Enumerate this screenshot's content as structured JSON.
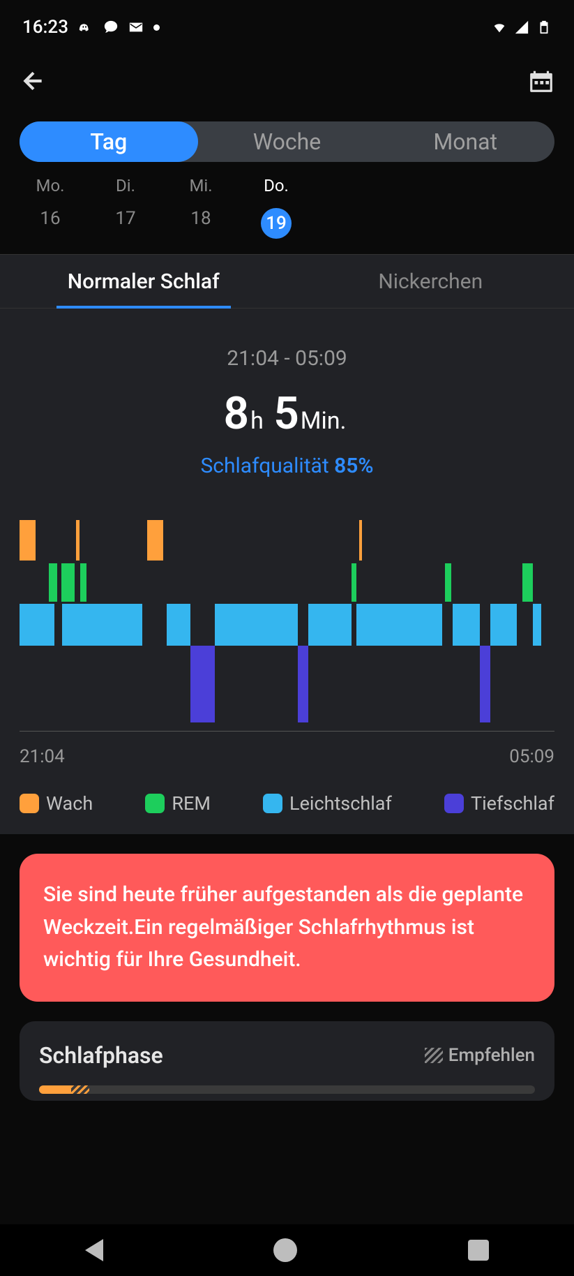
{
  "status": {
    "time": "16:23"
  },
  "segmented": {
    "items": [
      "Tag",
      "Woche",
      "Monat"
    ],
    "active": 0
  },
  "days": [
    {
      "wd": "Mo.",
      "num": "16"
    },
    {
      "wd": "Di.",
      "num": "17"
    },
    {
      "wd": "Mi.",
      "num": "18"
    },
    {
      "wd": "Do.",
      "num": "19"
    }
  ],
  "days_selected": 3,
  "tabs": {
    "items": [
      "Normaler Schlaf",
      "Nickerchen"
    ],
    "active": 0
  },
  "summary": {
    "time_range": "21:04 - 05:09",
    "hours": "8",
    "hours_unit": "h",
    "minutes": "5",
    "minutes_unit": "Min.",
    "quality_label": "Schlafqualität",
    "quality_pct": "85%"
  },
  "chart_data": {
    "type": "bar",
    "xlabel": "",
    "ylabel": "",
    "start_label": "21:04",
    "end_label": "05:09",
    "stages": [
      "wake",
      "rem",
      "light",
      "deep"
    ],
    "segments": [
      {
        "stage": "wake",
        "start_pct": 0,
        "width_pct": 3.0
      },
      {
        "stage": "rem",
        "start_pct": 5.5,
        "width_pct": 1.5
      },
      {
        "stage": "rem",
        "start_pct": 7.8,
        "width_pct": 2.5
      },
      {
        "stage": "wake",
        "start_pct": 10.5,
        "width_pct": 0.7
      },
      {
        "stage": "rem",
        "start_pct": 11.3,
        "width_pct": 1.2
      },
      {
        "stage": "light",
        "start_pct": 0,
        "width_pct": 6.5
      },
      {
        "stage": "light",
        "start_pct": 8.0,
        "width_pct": 15.0
      },
      {
        "stage": "wake",
        "start_pct": 23.8,
        "width_pct": 3.0
      },
      {
        "stage": "light",
        "start_pct": 27.5,
        "width_pct": 4.5
      },
      {
        "stage": "deep",
        "start_pct": 32.0,
        "width_pct": 4.5
      },
      {
        "stage": "light",
        "start_pct": 36.5,
        "width_pct": 15.5
      },
      {
        "stage": "deep",
        "start_pct": 52.0,
        "width_pct": 2.0
      },
      {
        "stage": "light",
        "start_pct": 54.0,
        "width_pct": 8.0
      },
      {
        "stage": "rem",
        "start_pct": 62.0,
        "width_pct": 1.0
      },
      {
        "stage": "wake",
        "start_pct": 63.5,
        "width_pct": 0.5
      },
      {
        "stage": "light",
        "start_pct": 63.0,
        "width_pct": 16.0
      },
      {
        "stage": "rem",
        "start_pct": 79.5,
        "width_pct": 1.2
      },
      {
        "stage": "light",
        "start_pct": 81.0,
        "width_pct": 5.0
      },
      {
        "stage": "deep",
        "start_pct": 86.0,
        "width_pct": 2.0
      },
      {
        "stage": "light",
        "start_pct": 88.0,
        "width_pct": 5.0
      },
      {
        "stage": "rem",
        "start_pct": 94.0,
        "width_pct": 2.0
      },
      {
        "stage": "light",
        "start_pct": 96.0,
        "width_pct": 1.5
      }
    ],
    "deep_heights": {
      "32.0": 120,
      "52.0": 130,
      "86.0": 120
    }
  },
  "legend": {
    "wake": "Wach",
    "rem": "REM",
    "light": "Leichtschlaf",
    "deep": "Tiefschlaf"
  },
  "tip": "Sie sind heute früher aufgestanden als die geplante Weckzeit.Ein regelmäßiger Schlafrhythmus ist wichtig für Ihre Gesundheit.",
  "phase_card": {
    "title": "Schlafphase",
    "recommend": "Empfehlen"
  }
}
